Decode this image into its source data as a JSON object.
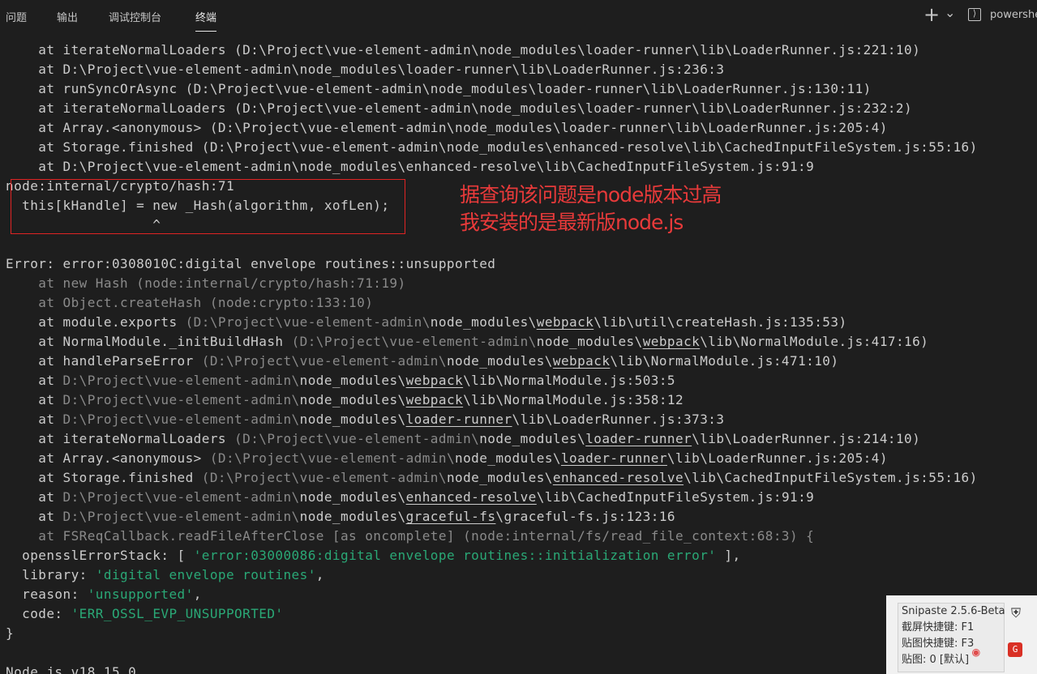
{
  "tabs": [
    {
      "label": "问题",
      "active": false
    },
    {
      "label": "输出",
      "active": false
    },
    {
      "label": "调试控制台",
      "active": false
    },
    {
      "label": "终端",
      "active": true
    }
  ],
  "toolbar": {
    "add_glyph": "+",
    "dropdown_glyph": "⌄",
    "shell_glyph": "⟩",
    "shell_label": "powershell"
  },
  "terminal_lines": [
    [
      {
        "t": "    at iterateNormalLoaders (D:\\Project\\vue-element-admin\\node_modules\\loader-runner\\lib\\LoaderRunner.js:221:10)"
      }
    ],
    [
      {
        "t": "    at D:\\Project\\vue-element-admin\\node_modules\\loader-runner\\lib\\LoaderRunner.js:236:3"
      }
    ],
    [
      {
        "t": "    at runSyncOrAsync (D:\\Project\\vue-element-admin\\node_modules\\loader-runner\\lib\\LoaderRunner.js:130:11)"
      }
    ],
    [
      {
        "t": "    at iterateNormalLoaders (D:\\Project\\vue-element-admin\\node_modules\\loader-runner\\lib\\LoaderRunner.js:232:2)"
      }
    ],
    [
      {
        "t": "    at Array.<anonymous> (D:\\Project\\vue-element-admin\\node_modules\\loader-runner\\lib\\LoaderRunner.js:205:4)"
      }
    ],
    [
      {
        "t": "    at Storage.finished (D:\\Project\\vue-element-admin\\node_modules\\enhanced-resolve\\lib\\CachedInputFileSystem.js:55:16)"
      }
    ],
    [
      {
        "t": "    at D:\\Project\\vue-element-admin\\node_modules\\enhanced-resolve\\lib\\CachedInputFileSystem.js:91:9"
      }
    ],
    [
      {
        "t": "node:internal/crypto/hash:71"
      }
    ],
    [
      {
        "t": "  this[kHandle] = new _Hash(algorithm, xofLen);"
      }
    ],
    [
      {
        "t": "                  ^"
      }
    ],
    [
      {
        "t": ""
      }
    ],
    [
      {
        "t": "Error: error:0308010C:digital envelope routines::unsupported"
      }
    ],
    [
      {
        "t": "    at new Hash (node:internal/crypto/hash:71:19)",
        "c": "dim"
      }
    ],
    [
      {
        "t": "    at Object.createHash (node:crypto:133:10)",
        "c": "dim"
      }
    ],
    [
      {
        "t": "    at module.exports "
      },
      {
        "t": "(D:\\Project\\vue-element-admin\\",
        "c": "dim"
      },
      {
        "t": "node_modules\\"
      },
      {
        "t": "webpack",
        "c": "ul"
      },
      {
        "t": "\\lib\\util\\createHash.js:135:53)"
      }
    ],
    [
      {
        "t": "    at NormalModule._initBuildHash "
      },
      {
        "t": "(D:\\Project\\vue-element-admin\\",
        "c": "dim"
      },
      {
        "t": "node_modules\\"
      },
      {
        "t": "webpack",
        "c": "ul"
      },
      {
        "t": "\\lib\\NormalModule.js:417:16)"
      }
    ],
    [
      {
        "t": "    at handleParseError "
      },
      {
        "t": "(D:\\Project\\vue-element-admin\\",
        "c": "dim"
      },
      {
        "t": "node_modules\\"
      },
      {
        "t": "webpack",
        "c": "ul"
      },
      {
        "t": "\\lib\\NormalModule.js:471:10)"
      }
    ],
    [
      {
        "t": "    at "
      },
      {
        "t": "D:\\Project\\vue-element-admin\\",
        "c": "dim"
      },
      {
        "t": "node_modules\\"
      },
      {
        "t": "webpack",
        "c": "ul"
      },
      {
        "t": "\\lib\\NormalModule.js:503:5"
      }
    ],
    [
      {
        "t": "    at "
      },
      {
        "t": "D:\\Project\\vue-element-admin\\",
        "c": "dim"
      },
      {
        "t": "node_modules\\"
      },
      {
        "t": "webpack",
        "c": "ul"
      },
      {
        "t": "\\lib\\NormalModule.js:358:12"
      }
    ],
    [
      {
        "t": "    at "
      },
      {
        "t": "D:\\Project\\vue-element-admin\\",
        "c": "dim"
      },
      {
        "t": "node_modules\\"
      },
      {
        "t": "loader-runner",
        "c": "ul"
      },
      {
        "t": "\\lib\\LoaderRunner.js:373:3"
      }
    ],
    [
      {
        "t": "    at iterateNormalLoaders "
      },
      {
        "t": "(D:\\Project\\vue-element-admin\\",
        "c": "dim"
      },
      {
        "t": "node_modules\\"
      },
      {
        "t": "loader-runner",
        "c": "ul"
      },
      {
        "t": "\\lib\\LoaderRunner.js:214:10)"
      }
    ],
    [
      {
        "t": "    at Array.<anonymous> "
      },
      {
        "t": "(D:\\Project\\vue-element-admin\\",
        "c": "dim"
      },
      {
        "t": "node_modules\\"
      },
      {
        "t": "loader-runner",
        "c": "ul"
      },
      {
        "t": "\\lib\\LoaderRunner.js:205:4)"
      }
    ],
    [
      {
        "t": "    at Storage.finished "
      },
      {
        "t": "(D:\\Project\\vue-element-admin\\",
        "c": "dim"
      },
      {
        "t": "node_modules\\"
      },
      {
        "t": "enhanced-resolve",
        "c": "ul"
      },
      {
        "t": "\\lib\\CachedInputFileSystem.js:55:16)"
      }
    ],
    [
      {
        "t": "    at "
      },
      {
        "t": "D:\\Project\\vue-element-admin\\",
        "c": "dim"
      },
      {
        "t": "node_modules\\"
      },
      {
        "t": "enhanced-resolve",
        "c": "ul"
      },
      {
        "t": "\\lib\\CachedInputFileSystem.js:91:9"
      }
    ],
    [
      {
        "t": "    at "
      },
      {
        "t": "D:\\Project\\vue-element-admin\\",
        "c": "dim"
      },
      {
        "t": "node_modules\\"
      },
      {
        "t": "graceful-fs",
        "c": "ul"
      },
      {
        "t": "\\graceful-fs.js:123:16"
      }
    ],
    [
      {
        "t": "    at FSReqCallback.readFileAfterClose [as oncomplete] (node:internal/fs/read_file_context:68:3) {",
        "c": "dim"
      }
    ],
    [
      {
        "t": "  opensslErrorStack: [ "
      },
      {
        "t": "'error:03000086:digital envelope routines::initialization error'",
        "c": "str"
      },
      {
        "t": " ],"
      }
    ],
    [
      {
        "t": "  library: "
      },
      {
        "t": "'digital envelope routines'",
        "c": "str"
      },
      {
        "t": ","
      }
    ],
    [
      {
        "t": "  reason: "
      },
      {
        "t": "'unsupported'",
        "c": "str"
      },
      {
        "t": ","
      }
    ],
    [
      {
        "t": "  code: "
      },
      {
        "t": "'ERR_OSSL_EVP_UNSUPPORTED'",
        "c": "str"
      }
    ],
    [
      {
        "t": "}"
      }
    ],
    [
      {
        "t": ""
      }
    ],
    [
      {
        "t": "Node.js v18.15.0"
      }
    ]
  ],
  "annotation": {
    "line1": "据查询该问题是node版本过高",
    "line2": "我安装的是最新版node.js",
    "color": "#e02424"
  },
  "snipaste_popup": {
    "title": "Snipaste 2.5.6-Beta",
    "line1": "截屏快捷键: F1",
    "line2": "贴图快捷键: F3",
    "line3": "贴图: 0 [默认]"
  }
}
